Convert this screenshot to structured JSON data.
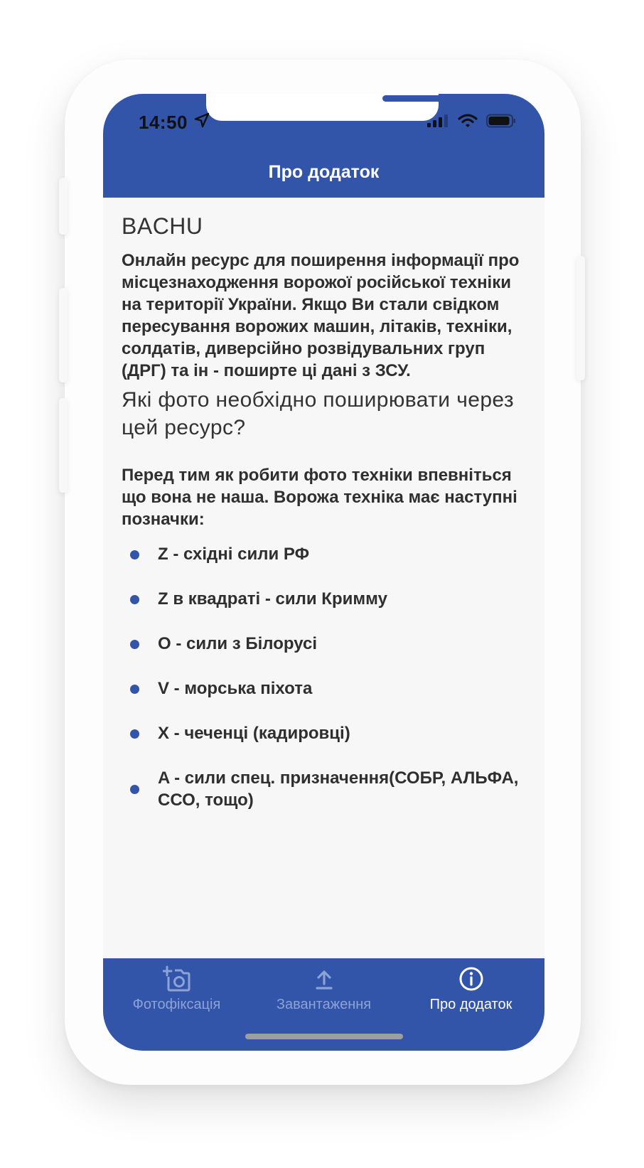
{
  "status_bar": {
    "time": "14:50"
  },
  "header": {
    "title": "Про додаток"
  },
  "content": {
    "app_name": "BACHU",
    "intro": "Онлайн ресурс для поширення інформації про місцезнаходження ворожої російської техніки на території України. Якщо Ви стали свідком пересування ворожих машин, літаків, техніки, солдатів, диверсійно розвідувальних груп (ДРГ) та ін - поширте ці дані з ЗСУ.",
    "question": "Які фото необхідно поширювати через цей ресурс?",
    "lead": "Перед тим як робити фото техніки впевніться що вона не наша. Ворожа техніка має наступні позначки:",
    "markers": [
      "Z - східні сили РФ",
      "Z в квадраті - сили Кримму",
      "O - сили з Білорусі",
      "V - морська піхота",
      "X - чеченці (кадировці)",
      "A - сили спец. призначення(СОБР, АЛЬФА, ССО, тощо)"
    ]
  },
  "tabs": [
    {
      "label": "Фотофіксація",
      "icon": "add-photo-icon",
      "active": false
    },
    {
      "label": "Завантаження",
      "icon": "upload-icon",
      "active": false
    },
    {
      "label": "Про додаток",
      "icon": "info-icon",
      "active": true
    }
  ],
  "colors": {
    "brand_blue": "#3254a9",
    "inactive_tab": "#8da3d8",
    "text": "#2f2f2f",
    "background": "#f7f7f7"
  }
}
